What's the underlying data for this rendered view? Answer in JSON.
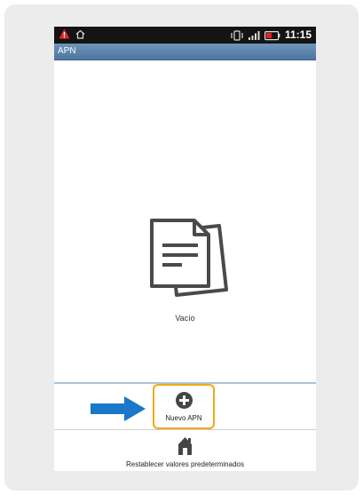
{
  "statusbar": {
    "time": "11:15",
    "icons": [
      "warning-icon",
      "home-icon",
      "vibrate-icon",
      "signal-icon",
      "battery-icon"
    ]
  },
  "titlebar": {
    "title": "APN"
  },
  "empty_state": {
    "icon": "documents-icon",
    "label": "Vacío"
  },
  "bottom_actions": {
    "new_apn_label": "Nuevo APN",
    "new_apn_icon": "add-circle-icon",
    "reset_label": "Restablecer valores predeterminados",
    "reset_icon": "home-reset-icon"
  },
  "colors": {
    "highlight": "#f2a814",
    "arrow": "#1b77c9",
    "titlebar": "#5b84ad"
  }
}
